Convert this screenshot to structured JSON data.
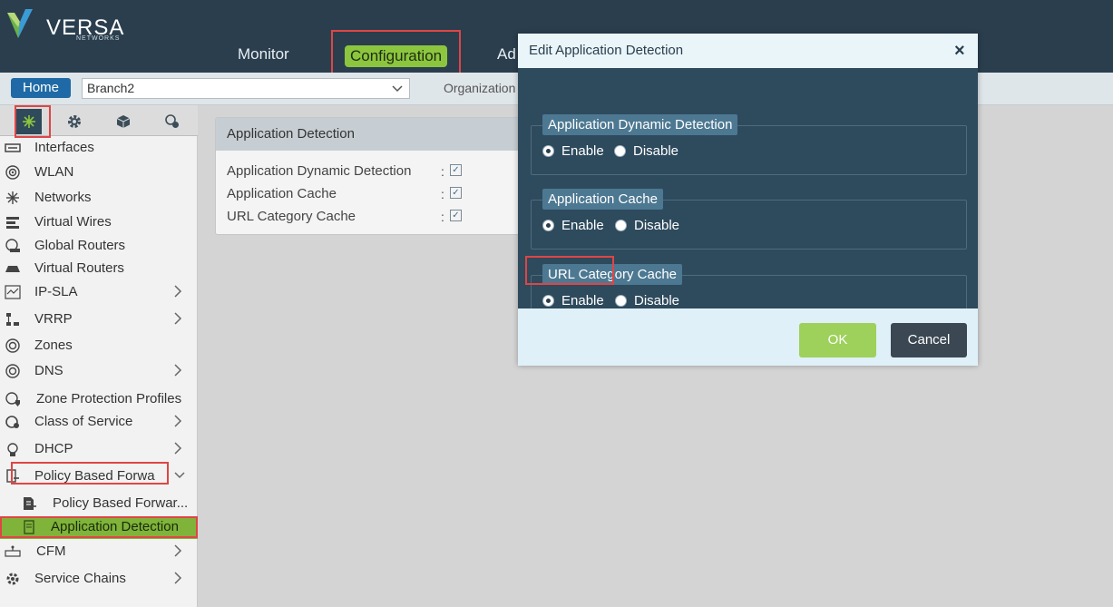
{
  "header": {
    "logo_text": "VERSA",
    "logo_sub": "NETWORKS",
    "nav": {
      "monitor": "Monitor",
      "configuration": "Configuration",
      "admin": "Ad"
    }
  },
  "subbar": {
    "home": "Home",
    "branch": "Branch2",
    "organization": "Organization"
  },
  "sidebar": {
    "items": [
      {
        "label": "Interfaces",
        "icon": "interfaces-icon"
      },
      {
        "label": "WLAN",
        "icon": "wlan-icon"
      },
      {
        "label": "Networks",
        "icon": "networks-icon"
      },
      {
        "label": "Virtual Wires",
        "icon": "virtual-wires-icon"
      },
      {
        "label": "Global Routers",
        "icon": "global-routers-icon"
      },
      {
        "label": "Virtual Routers",
        "icon": "virtual-routers-icon"
      },
      {
        "label": "IP-SLA",
        "icon": "ip-sla-icon"
      },
      {
        "label": "VRRP",
        "icon": "vrrp-icon"
      },
      {
        "label": "Zones",
        "icon": "zones-icon"
      },
      {
        "label": "DNS",
        "icon": "dns-icon"
      },
      {
        "label": "Zone Protection Profiles",
        "icon": "zone-protection-icon"
      },
      {
        "label": "Class of Service",
        "icon": "class-of-service-icon"
      },
      {
        "label": "DHCP",
        "icon": "dhcp-icon"
      },
      {
        "label": "Policy Based Forwa",
        "icon": "policy-based-forwarding-icon"
      },
      {
        "label": "Policy Based Forwar...",
        "icon": "policy-icon"
      },
      {
        "label": "Application Detection",
        "icon": "application-detection-icon"
      },
      {
        "label": "CFM",
        "icon": "cfm-icon"
      },
      {
        "label": "Service Chains",
        "icon": "service-chains-icon"
      }
    ]
  },
  "panel": {
    "title": "Application Detection",
    "rows": [
      {
        "label": "Application Dynamic Detection",
        "colon": ":"
      },
      {
        "label": "Application Cache",
        "colon": ":"
      },
      {
        "label": "URL Category Cache",
        "colon": ":"
      }
    ]
  },
  "modal": {
    "title": "Edit Application Detection",
    "close": "×",
    "groups": [
      {
        "legend": "Application Dynamic Detection",
        "enable": "Enable",
        "disable": "Disable",
        "selected": "Enable"
      },
      {
        "legend": "Application Cache",
        "enable": "Enable",
        "disable": "Disable",
        "selected": "Enable"
      },
      {
        "legend": "URL Category Cache",
        "enable": "Enable",
        "disable": "Disable",
        "selected": "Enable"
      }
    ],
    "ok": "OK",
    "cancel": "Cancel"
  },
  "colors": {
    "header_bg": "#2a3e4e",
    "accent_green": "#8cc63e",
    "highlight_red": "#e04545",
    "modal_body": "#2e4a5d"
  }
}
